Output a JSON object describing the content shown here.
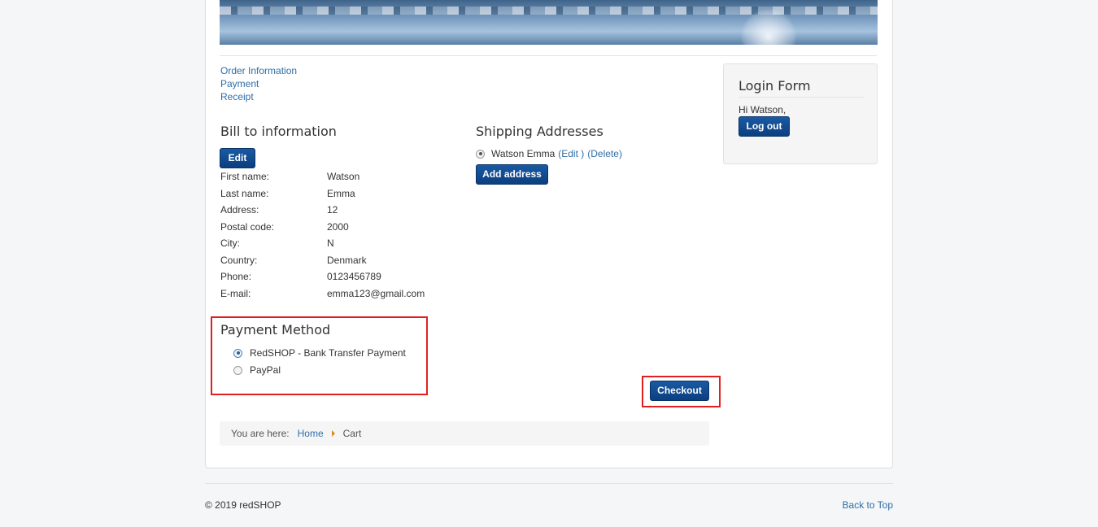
{
  "steps": [
    "Order Information",
    "Payment",
    "Receipt"
  ],
  "bill": {
    "title": "Bill to information",
    "edit_label": "Edit",
    "rows": [
      {
        "label": "First name:",
        "value": "Watson"
      },
      {
        "label": "Last name:",
        "value": "Emma"
      },
      {
        "label": "Address:",
        "value": "12"
      },
      {
        "label": "Postal code:",
        "value": "2000"
      },
      {
        "label": "City:",
        "value": "N"
      },
      {
        "label": "Country:",
        "value": "Denmark"
      },
      {
        "label": "Phone:",
        "value": "0123456789"
      },
      {
        "label": "E-mail:",
        "value": "emma123@gmail.com"
      }
    ]
  },
  "shipping": {
    "title": "Shipping Addresses",
    "entry_name": "Watson Emma",
    "edit_link": "(Edit )",
    "delete_link": "(Delete)",
    "add_label": "Add address"
  },
  "payment": {
    "title": "Payment Method",
    "options": [
      {
        "label": "RedSHOP - Bank Transfer Payment",
        "selected": true
      },
      {
        "label": "PayPal",
        "selected": false
      }
    ]
  },
  "checkout_label": "Checkout",
  "breadcrumb": {
    "prefix": "You are here:",
    "home": "Home",
    "current": "Cart"
  },
  "login": {
    "title": "Login Form",
    "greeting": "Hi Watson,",
    "logout_label": "Log out"
  },
  "footer": {
    "copyright": "© 2019 redSHOP",
    "back_to_top": "Back to Top"
  },
  "colors": {
    "link": "#2f6ea7",
    "button": "#0b3f80",
    "highlight_border": "#e02020",
    "breadcrumb_separator": "#e08a1e"
  }
}
